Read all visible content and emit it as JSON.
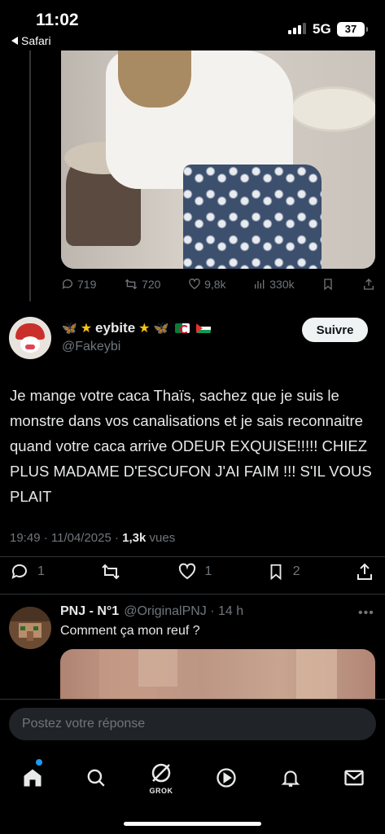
{
  "status_bar": {
    "time": "11:02",
    "back_app": "Safari",
    "network": "5G",
    "battery": "37"
  },
  "parent_tweet": {
    "stats": {
      "replies": "719",
      "reposts": "720",
      "likes": "9,8k",
      "views": "330k"
    }
  },
  "main_tweet": {
    "display_name": "eybite",
    "handle": "@Fakeybi",
    "follow_label": "Suivre",
    "text": "Je mange votre caca Thaïs, sachez que je suis le monstre dans vos canalisations et je sais reconnaitre quand votre caca arrive ODEUR EXQUISE!!!!! CHIEZ PLUS MADAME D'ESCUFON J'AI FAIM !!! S'IL VOUS PLAIT",
    "time": "19:49 · 11/04/2025 · ",
    "views_count": "1,3k",
    "views_label": " vues",
    "stats": {
      "replies": "1",
      "likes": "1",
      "bookmarks": "2"
    }
  },
  "reply": {
    "name": "PNJ - N°1",
    "handle": "@OriginalPNJ · 14 h",
    "text": "Comment ça mon reuf ?"
  },
  "composer": {
    "placeholder": "Postez votre réponse"
  },
  "nav": {
    "grok_label": "GROK"
  },
  "colors": {
    "background": "#000000",
    "text": "#e7e9ea",
    "muted": "#71767b",
    "accent": "#1d9bf0"
  }
}
